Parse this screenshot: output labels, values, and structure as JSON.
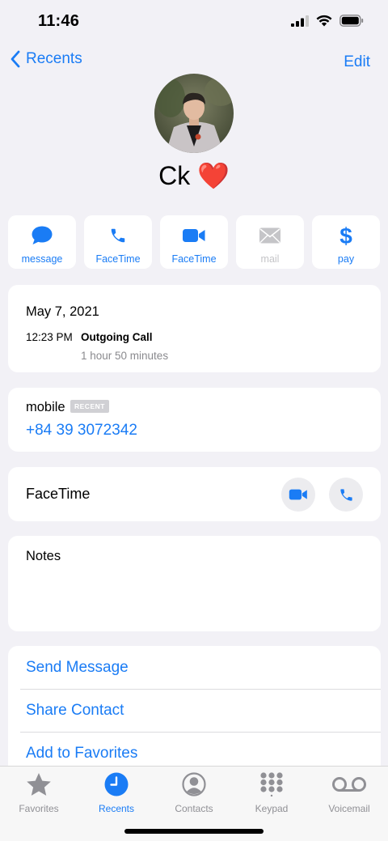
{
  "status_bar": {
    "time": "11:46"
  },
  "nav": {
    "back_label": "Recents",
    "edit_label": "Edit"
  },
  "contact": {
    "name": "Ck ❤️"
  },
  "actions": [
    {
      "label": "message",
      "icon": "message-bubble-icon",
      "enabled": true
    },
    {
      "label": "FaceTime",
      "icon": "phone-icon",
      "enabled": true
    },
    {
      "label": "FaceTime",
      "icon": "video-camera-icon",
      "enabled": true
    },
    {
      "label": "mail",
      "icon": "envelope-icon",
      "enabled": false
    },
    {
      "label": "pay",
      "icon": "dollar-icon",
      "enabled": true
    }
  ],
  "call_log": {
    "date": "May 7, 2021",
    "time": "12:23 PM",
    "type": "Outgoing Call",
    "duration": "1 hour 50 minutes"
  },
  "phone": {
    "label": "mobile",
    "badge": "RECENT",
    "number": "+84 39 3072342"
  },
  "facetime": {
    "label": "FaceTime"
  },
  "notes": {
    "label": "Notes"
  },
  "options": [
    "Send Message",
    "Share Contact",
    "Add to Favorites"
  ],
  "tabs": [
    {
      "label": "Favorites",
      "icon": "star-icon",
      "active": false
    },
    {
      "label": "Recents",
      "icon": "clock-icon",
      "active": true
    },
    {
      "label": "Contacts",
      "icon": "person-circle-icon",
      "active": false
    },
    {
      "label": "Keypad",
      "icon": "keypad-icon",
      "active": false
    },
    {
      "label": "Voicemail",
      "icon": "voicemail-icon",
      "active": false
    }
  ],
  "colors": {
    "accent": "#1a7cf5",
    "background": "#f2f1f6",
    "disabled": "#c5c5c8",
    "inactive_tab": "#909095"
  }
}
